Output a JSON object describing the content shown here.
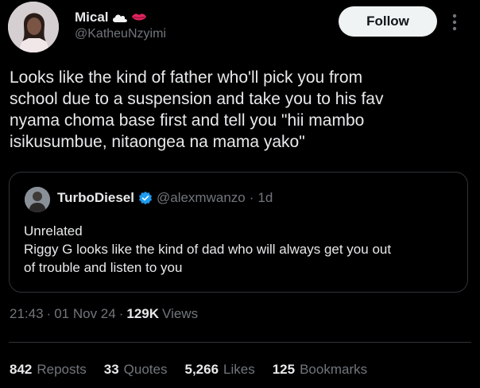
{
  "author": {
    "display_name": "Mical",
    "name_icons": [
      "cloud-icon",
      "lips-icon"
    ],
    "handle": "@KatheuNzyimi"
  },
  "follow_label": "Follow",
  "tweet_text": "Looks like the kind of father who'll pick you from\nschool due to a suspension and take you to his fav\nnyama choma base first and tell you \"hii mambo\nisikusumbue, nitaongea na mama yako\"",
  "quote": {
    "display_name": "TurboDiesel",
    "verified_icon": "verified-badge-icon",
    "handle": "@alexmwanzo",
    "separator": "·",
    "time": "1d",
    "text": "Unrelated\nRiggy G looks like the kind of dad who will always get you out\nof trouble  and listen to you"
  },
  "meta": {
    "time": "21:43",
    "separator": "·",
    "date": "01 Nov 24",
    "views_count": "129K",
    "views_label": "Views"
  },
  "stats": [
    {
      "count": "842",
      "label": "Reposts"
    },
    {
      "count": "33",
      "label": "Quotes"
    },
    {
      "count": "5,266",
      "label": "Likes"
    },
    {
      "count": "125",
      "label": "Bookmarks"
    }
  ],
  "colors": {
    "background": "#000000",
    "text": "#e7e9ea",
    "muted": "#71767b",
    "border": "#2f3336",
    "verified": "#1d9bf0",
    "lips": "#e0245e"
  }
}
